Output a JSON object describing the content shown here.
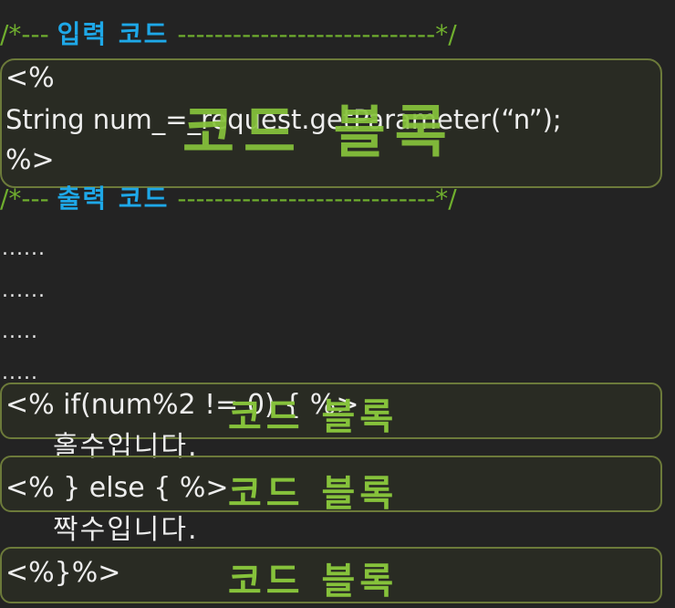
{
  "input_comment": {
    "prefix": "/*--- ",
    "label": "입력 코드",
    "suffix": " ----------------------------*/"
  },
  "output_comment": {
    "prefix": "/*--- ",
    "label": "출력 코드",
    "suffix": " ----------------------------*/"
  },
  "code_lines": {
    "open_tag": "<%",
    "request_line": "String num_=_request.getParameter(“n”);",
    "close_tag": "%>",
    "if_line": "<% if(num%2 != 0) { %>",
    "odd_text": "홀수입니다.",
    "else_line": "<% } else { %>",
    "even_text": "짝수입니다.",
    "end_line": "<%}%>"
  },
  "dots": [
    "......",
    "......",
    ".....",
    "....."
  ],
  "block_label": "코드 블록",
  "colors": {
    "background": "#232323",
    "comment": "#6fae2e",
    "comment_label": "#1ea8e8",
    "block_border": "#6c7a3a",
    "block_label": "#86c23b",
    "text": "#ececec"
  }
}
